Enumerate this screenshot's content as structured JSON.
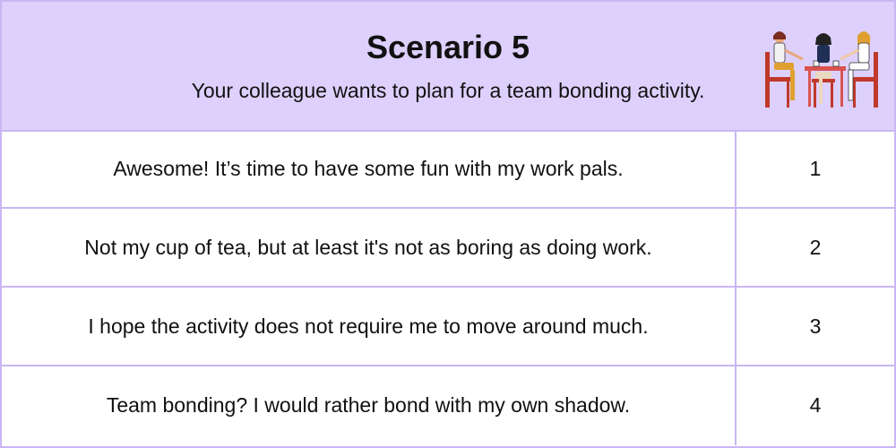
{
  "header": {
    "title": "Scenario 5",
    "subtitle": "Your colleague wants to plan for a team bonding activity.",
    "illustration_icon": "three-women-at-table-illustration"
  },
  "rows": [
    {
      "text": "Awesome! It’s time to have some fun with my work pals.",
      "number": "1"
    },
    {
      "text": "Not my cup of tea, but at least it's not as boring as doing work.",
      "number": "2"
    },
    {
      "text": "I hope the activity does not require me to move around much.",
      "number": "3"
    },
    {
      "text": "Team bonding? I would rather bond with my own shadow.",
      "number": "4"
    }
  ],
  "colors": {
    "header_bg": "#ddd0fc",
    "border": "#c9b6f2",
    "text": "#111111"
  }
}
